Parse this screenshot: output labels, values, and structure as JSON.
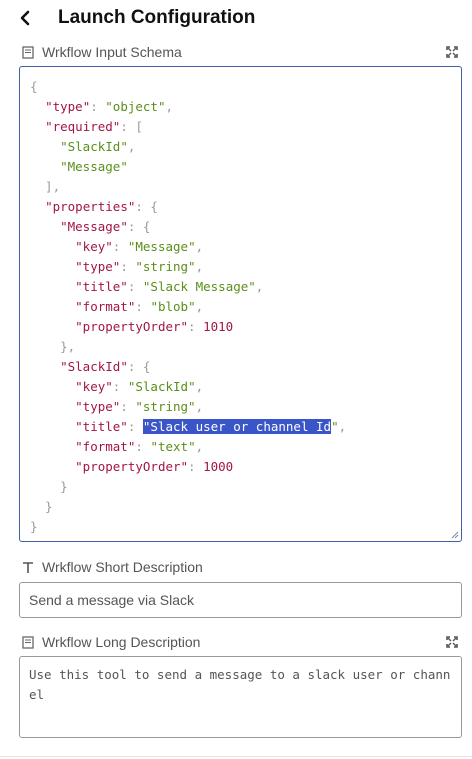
{
  "header": {
    "title": "Launch Configuration"
  },
  "schema_field": {
    "label": "Wrkflow Input Schema"
  },
  "schema_code": [
    [
      [
        "p",
        "{"
      ]
    ],
    [
      [
        "p",
        "  "
      ],
      [
        "k",
        "\"type\""
      ],
      [
        "p",
        ": "
      ],
      [
        "s",
        "\"object\""
      ],
      [
        "p",
        ","
      ]
    ],
    [
      [
        "p",
        "  "
      ],
      [
        "k",
        "\"required\""
      ],
      [
        "p",
        ": ["
      ]
    ],
    [
      [
        "p",
        "    "
      ],
      [
        "s",
        "\"SlackId\""
      ],
      [
        "p",
        ","
      ]
    ],
    [
      [
        "p",
        "    "
      ],
      [
        "s",
        "\"Message\""
      ]
    ],
    [
      [
        "p",
        "  ],"
      ]
    ],
    [
      [
        "p",
        "  "
      ],
      [
        "k",
        "\"properties\""
      ],
      [
        "p",
        ": {"
      ]
    ],
    [
      [
        "p",
        "    "
      ],
      [
        "k",
        "\"Message\""
      ],
      [
        "p",
        ": {"
      ]
    ],
    [
      [
        "p",
        "      "
      ],
      [
        "k",
        "\"key\""
      ],
      [
        "p",
        ": "
      ],
      [
        "s",
        "\"Message\""
      ],
      [
        "p",
        ","
      ]
    ],
    [
      [
        "p",
        "      "
      ],
      [
        "k",
        "\"type\""
      ],
      [
        "p",
        ": "
      ],
      [
        "s",
        "\"string\""
      ],
      [
        "p",
        ","
      ]
    ],
    [
      [
        "p",
        "      "
      ],
      [
        "k",
        "\"title\""
      ],
      [
        "p",
        ": "
      ],
      [
        "s",
        "\"Slack Message\""
      ],
      [
        "p",
        ","
      ]
    ],
    [
      [
        "p",
        "      "
      ],
      [
        "k",
        "\"format\""
      ],
      [
        "p",
        ": "
      ],
      [
        "s",
        "\"blob\""
      ],
      [
        "p",
        ","
      ]
    ],
    [
      [
        "p",
        "      "
      ],
      [
        "k",
        "\"propertyOrder\""
      ],
      [
        "p",
        ": "
      ],
      [
        "n",
        "1010"
      ]
    ],
    [
      [
        "p",
        "    },"
      ]
    ],
    [
      [
        "p",
        "    "
      ],
      [
        "k",
        "\"SlackId\""
      ],
      [
        "p",
        ": {"
      ]
    ],
    [
      [
        "p",
        "      "
      ],
      [
        "k",
        "\"key\""
      ],
      [
        "p",
        ": "
      ],
      [
        "s",
        "\"SlackId\""
      ],
      [
        "p",
        ","
      ]
    ],
    [
      [
        "p",
        "      "
      ],
      [
        "k",
        "\"type\""
      ],
      [
        "p",
        ": "
      ],
      [
        "s",
        "\"string\""
      ],
      [
        "p",
        ","
      ]
    ],
    [
      [
        "p",
        "      "
      ],
      [
        "k",
        "\"title\""
      ],
      [
        "p",
        ": "
      ],
      [
        "hl",
        "\"Slack user or channel Id"
      ],
      [
        "s",
        "\""
      ],
      [
        "p",
        ","
      ]
    ],
    [
      [
        "p",
        "      "
      ],
      [
        "k",
        "\"format\""
      ],
      [
        "p",
        ": "
      ],
      [
        "s",
        "\"text\""
      ],
      [
        "p",
        ","
      ]
    ],
    [
      [
        "p",
        "      "
      ],
      [
        "k",
        "\"propertyOrder\""
      ],
      [
        "p",
        ": "
      ],
      [
        "n",
        "1000"
      ]
    ],
    [
      [
        "p",
        "    }"
      ]
    ],
    [
      [
        "p",
        "  }"
      ]
    ],
    [
      [
        "p",
        "}"
      ]
    ]
  ],
  "short_description": {
    "label": "Wrkflow Short Description",
    "value": "Send a message via Slack"
  },
  "long_description": {
    "label": "Wrkflow Long Description",
    "value": "Use this tool to send a message to a slack user or channel"
  }
}
